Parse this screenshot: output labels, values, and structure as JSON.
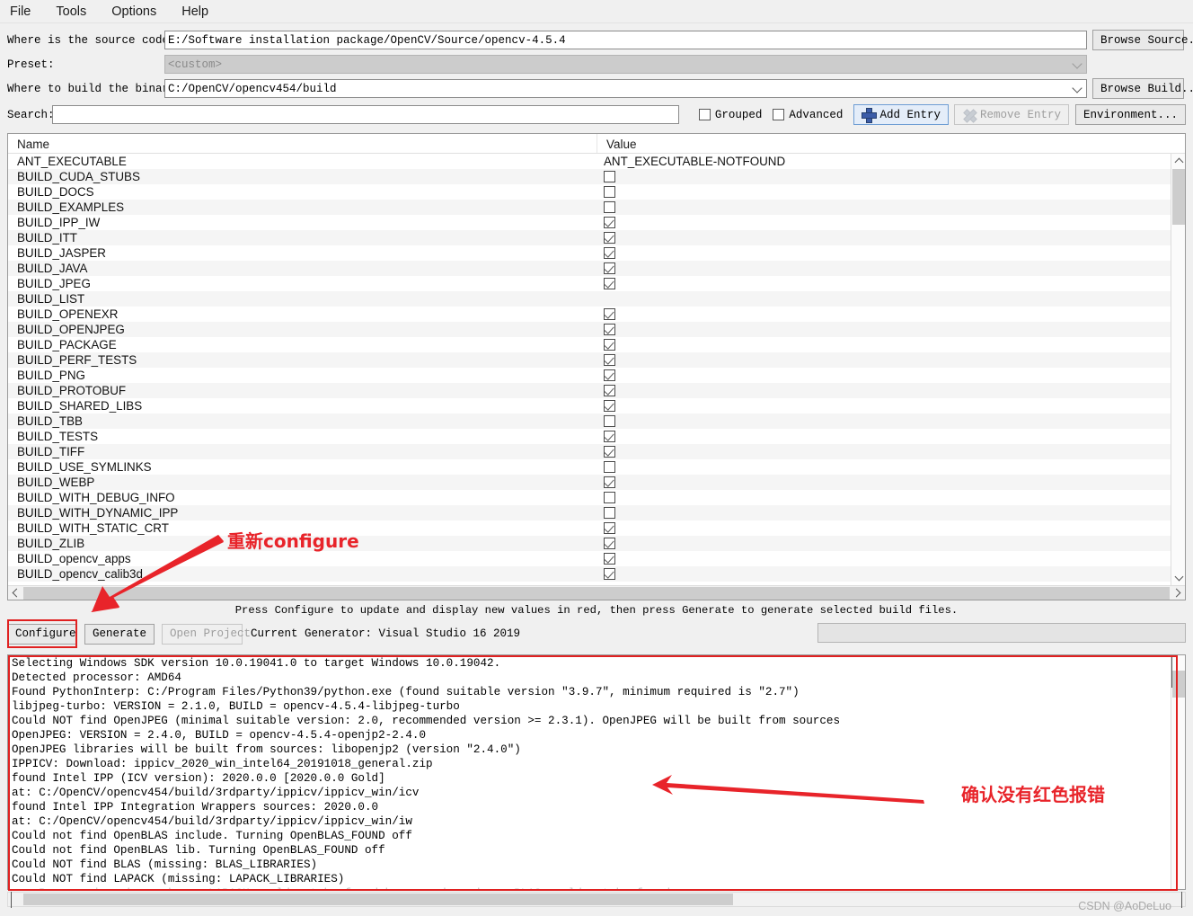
{
  "menubar": {
    "items": [
      {
        "label": "File",
        "name": "menu-file"
      },
      {
        "label": "Tools",
        "name": "menu-tools"
      },
      {
        "label": "Options",
        "name": "menu-options"
      },
      {
        "label": "Help",
        "name": "menu-help"
      }
    ]
  },
  "form": {
    "source_label": "Where is the source code:",
    "source_value": "E:/Software installation package/OpenCV/Source/opencv-4.5.4",
    "browse_source_label": "Browse Source...",
    "preset_label": "Preset:",
    "preset_value": "<custom>",
    "build_label": "Where to build the binaries:",
    "build_value": "C:/OpenCV/opencv454/build",
    "browse_build_label": "Browse Build...",
    "search_label": "Search:",
    "search_value": "",
    "grouped_label": "Grouped",
    "advanced_label": "Advanced",
    "add_entry_label": "Add Entry",
    "remove_entry_label": "Remove Entry",
    "environment_label": "Environment..."
  },
  "table": {
    "headers": {
      "name": "Name",
      "value": "Value"
    },
    "rows": [
      {
        "name": "ANT_EXECUTABLE",
        "kind": "text",
        "value": "ANT_EXECUTABLE-NOTFOUND"
      },
      {
        "name": "BUILD_CUDA_STUBS",
        "kind": "checkbox",
        "checked": false
      },
      {
        "name": "BUILD_DOCS",
        "kind": "checkbox",
        "checked": false
      },
      {
        "name": "BUILD_EXAMPLES",
        "kind": "checkbox",
        "checked": false
      },
      {
        "name": "BUILD_IPP_IW",
        "kind": "checkbox",
        "checked": true
      },
      {
        "name": "BUILD_ITT",
        "kind": "checkbox",
        "checked": true
      },
      {
        "name": "BUILD_JASPER",
        "kind": "checkbox",
        "checked": true
      },
      {
        "name": "BUILD_JAVA",
        "kind": "checkbox",
        "checked": true
      },
      {
        "name": "BUILD_JPEG",
        "kind": "checkbox",
        "checked": true
      },
      {
        "name": "BUILD_LIST",
        "kind": "text",
        "value": ""
      },
      {
        "name": "BUILD_OPENEXR",
        "kind": "checkbox",
        "checked": true
      },
      {
        "name": "BUILD_OPENJPEG",
        "kind": "checkbox",
        "checked": true
      },
      {
        "name": "BUILD_PACKAGE",
        "kind": "checkbox",
        "checked": true
      },
      {
        "name": "BUILD_PERF_TESTS",
        "kind": "checkbox",
        "checked": true
      },
      {
        "name": "BUILD_PNG",
        "kind": "checkbox",
        "checked": true
      },
      {
        "name": "BUILD_PROTOBUF",
        "kind": "checkbox",
        "checked": true
      },
      {
        "name": "BUILD_SHARED_LIBS",
        "kind": "checkbox",
        "checked": true
      },
      {
        "name": "BUILD_TBB",
        "kind": "checkbox",
        "checked": false
      },
      {
        "name": "BUILD_TESTS",
        "kind": "checkbox",
        "checked": true
      },
      {
        "name": "BUILD_TIFF",
        "kind": "checkbox",
        "checked": true
      },
      {
        "name": "BUILD_USE_SYMLINKS",
        "kind": "checkbox",
        "checked": false
      },
      {
        "name": "BUILD_WEBP",
        "kind": "checkbox",
        "checked": true
      },
      {
        "name": "BUILD_WITH_DEBUG_INFO",
        "kind": "checkbox",
        "checked": false
      },
      {
        "name": "BUILD_WITH_DYNAMIC_IPP",
        "kind": "checkbox",
        "checked": false
      },
      {
        "name": "BUILD_WITH_STATIC_CRT",
        "kind": "checkbox",
        "checked": true
      },
      {
        "name": "BUILD_ZLIB",
        "kind": "checkbox",
        "checked": true
      },
      {
        "name": "BUILD_opencv_apps",
        "kind": "checkbox",
        "checked": true
      },
      {
        "name": "BUILD_opencv_calib3d",
        "kind": "checkbox",
        "checked": true
      }
    ]
  },
  "actions": {
    "hint": "Press Configure to update and display new values in red, then press Generate to generate selected build files.",
    "configure_label": "Configure",
    "generate_label": "Generate",
    "open_project_label": "Open Project",
    "current_generator": "Current Generator: Visual Studio 16 2019"
  },
  "log": {
    "lines": [
      "Selecting Windows SDK version 10.0.19041.0 to target Windows 10.0.19042.",
      "Detected processor: AMD64",
      "Found PythonInterp: C:/Program Files/Python39/python.exe (found suitable version \"3.9.7\", minimum required is \"2.7\")",
      "libjpeg-turbo: VERSION = 2.1.0, BUILD = opencv-4.5.4-libjpeg-turbo",
      "Could NOT find OpenJPEG (minimal suitable version: 2.0, recommended version >= 2.3.1). OpenJPEG will be built from sources",
      "OpenJPEG: VERSION = 2.4.0, BUILD = opencv-4.5.4-openjp2-2.4.0",
      "OpenJPEG libraries will be built from sources: libopenjp2 (version \"2.4.0\")",
      "IPPICV: Download: ippicv_2020_win_intel64_20191018_general.zip",
      "found Intel IPP (ICV version): 2020.0.0 [2020.0.0 Gold]",
      "at: C:/OpenCV/opencv454/build/3rdparty/ippicv/ippicv_win/icv",
      "found Intel IPP Integration Wrappers sources: 2020.0.0",
      "at: C:/OpenCV/opencv454/build/3rdparty/ippicv/ippicv_win/iw",
      "Could not find OpenBLAS include. Turning OpenBLAS_FOUND off",
      "Could not find OpenBLAS lib. Turning OpenBLAS_FOUND off",
      "Could NOT find BLAS (missing: BLAS_LIBRARIES)",
      "Could NOT find LAPACK (missing: LAPACK_LIBRARIES)",
      "    Reason given by package: LAPACK could not be found because dependency BLAS could not be found"
    ]
  },
  "annotations": {
    "configure_note": "重新configure",
    "log_note": "确认没有红色报错",
    "accent_red": "#e8242a",
    "box_red": "#e02020"
  },
  "watermark": "CSDN @AoDeLuo"
}
